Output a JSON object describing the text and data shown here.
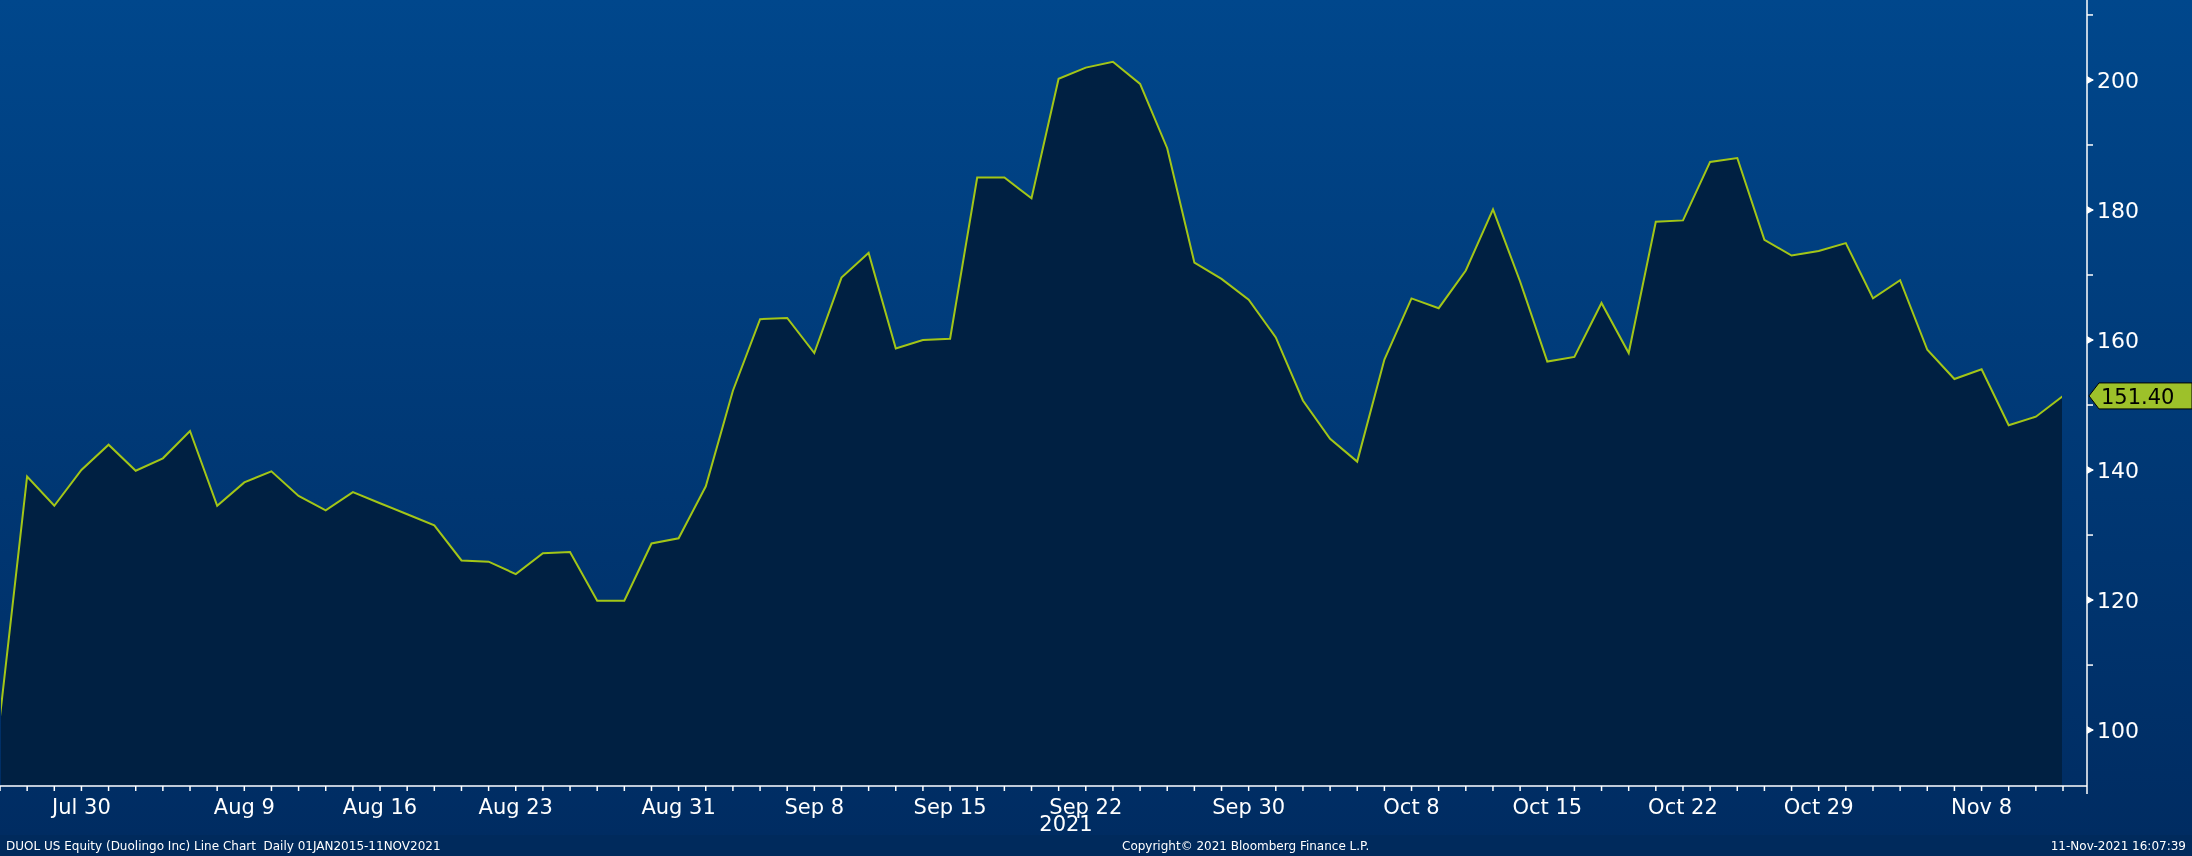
{
  "chart_data": {
    "type": "area",
    "xlabel": "2021",
    "categories": [
      null,
      null,
      null,
      "Jul 30",
      null,
      null,
      null,
      null,
      null,
      "Aug 9",
      null,
      null,
      null,
      null,
      "Aug 16",
      null,
      null,
      null,
      null,
      "Aug 23",
      null,
      null,
      null,
      null,
      null,
      "Aug 31",
      null,
      null,
      null,
      null,
      "Sep 8",
      null,
      null,
      null,
      null,
      "Sep 15",
      null,
      null,
      null,
      null,
      "Sep 22",
      null,
      null,
      null,
      null,
      null,
      "Sep 30",
      null,
      null,
      null,
      null,
      null,
      "Oct 8",
      null,
      null,
      null,
      null,
      "Oct 15",
      null,
      null,
      null,
      null,
      "Oct 22",
      null,
      null,
      null,
      null,
      "Oct 29",
      null,
      null,
      null,
      null,
      null,
      "Nov 8",
      null,
      null,
      null
    ],
    "series": [
      {
        "color": "#a3c617",
        "values": [
          102.1,
          139.0,
          134.5,
          140.0,
          143.9,
          139.9,
          141.8,
          146.0,
          134.5,
          138.1,
          139.8,
          136.0,
          133.8,
          136.6,
          134.9,
          133.2,
          131.5,
          126.1,
          125.9,
          124.0,
          127.2,
          127.4,
          119.9,
          119.9,
          128.7,
          129.5,
          137.5,
          152.2,
          163.2,
          163.4,
          158.0,
          169.6,
          173.4,
          158.7,
          160.0,
          160.2,
          185.0,
          185.0,
          181.8,
          200.2,
          201.9,
          202.8,
          199.4,
          189.5,
          171.9,
          169.4,
          166.2,
          160.4,
          150.7,
          144.8,
          141.3,
          157.0,
          166.4,
          164.9,
          170.7,
          180.1,
          169.0,
          156.7,
          157.4,
          165.7,
          158.0,
          178.2,
          178.4,
          187.4,
          188.0,
          175.4,
          173.0,
          173.7,
          174.9,
          166.4,
          169.2,
          158.5,
          154.0,
          155.5,
          146.9,
          148.2,
          151.4
        ]
      }
    ],
    "ylim": [
      91.4,
      212.3
    ],
    "yticks": [
      100,
      120,
      140,
      160,
      180,
      200
    ],
    "annotations": [
      "151.40"
    ]
  },
  "footer": {
    "left": "DUOL US Equity (Duolingo Inc) Line Chart  Daily 01JAN2015-11NOV2021",
    "center": "Copyright© 2021 Bloomberg Finance L.P.",
    "right": "11-Nov-2021 16:07:39"
  }
}
